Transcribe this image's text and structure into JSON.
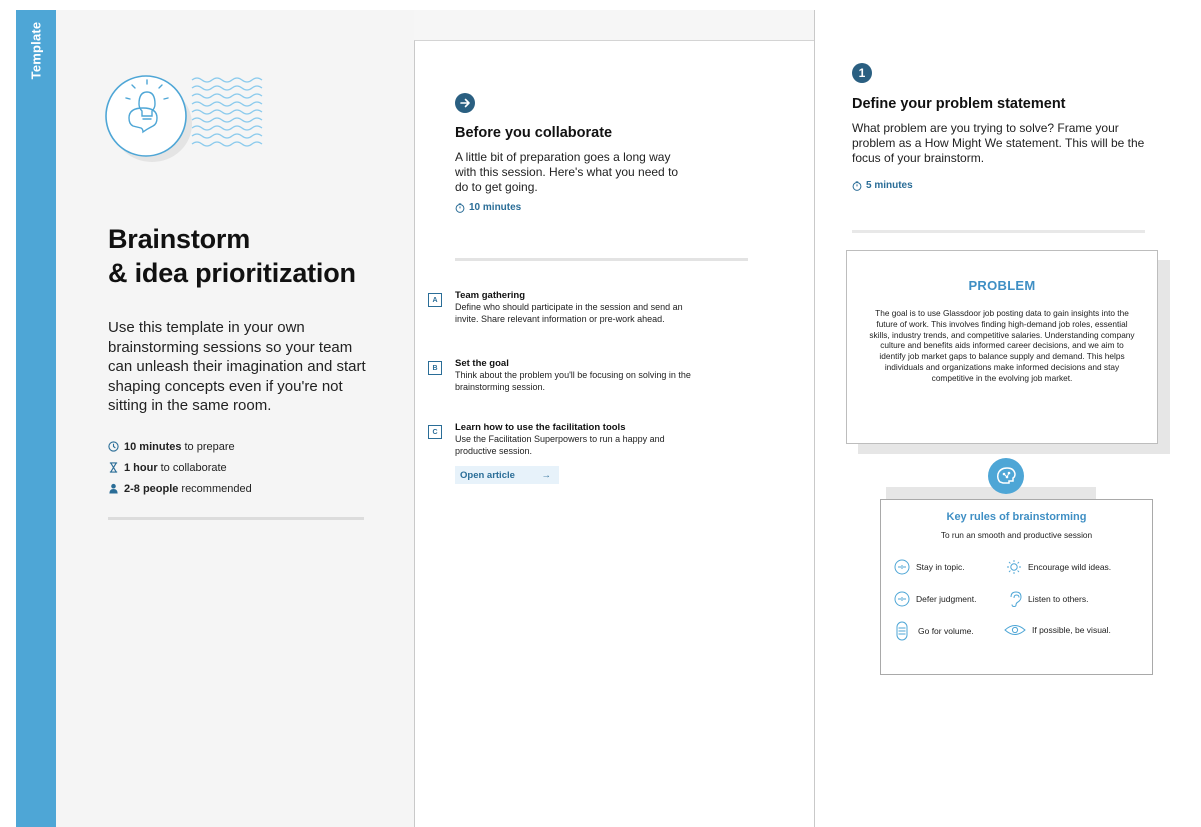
{
  "sidebar": {
    "label": "Template"
  },
  "intro": {
    "title_line1": "Brainstorm",
    "title_line2": "& idea prioritization",
    "description": "Use this template in your own brainstorming sessions so your team can unleash their imagination and start shaping concepts even if you're not sitting in the same room.",
    "meta": [
      {
        "icon": "clock-icon",
        "bold": "10 minutes",
        "text": "to prepare"
      },
      {
        "icon": "hourglass-icon",
        "bold": "1 hour",
        "text": "to collaborate"
      },
      {
        "icon": "person-icon",
        "bold": "2-8 people",
        "text": "recommended"
      }
    ]
  },
  "prep": {
    "heading": "Before you collaborate",
    "description": "A little bit of preparation goes a long way with this session. Here's what you need to do to get going.",
    "timer": "10 minutes",
    "steps": [
      {
        "letter": "A",
        "title": "Team gathering",
        "desc": "Define who should participate in the session and send an invite. Share relevant information or pre-work ahead."
      },
      {
        "letter": "B",
        "title": "Set the goal",
        "desc": "Think about the problem you'll be focusing on solving in the brainstorming session."
      },
      {
        "letter": "C",
        "title": "Learn how to use the facilitation tools",
        "desc": "Use the Facilitation Superpowers to run a happy and productive session."
      }
    ],
    "open_article": "Open article",
    "open_article_arrow": "→"
  },
  "define": {
    "step_number": "1",
    "heading": "Define your problem statement",
    "description": "What problem are you trying to solve? Frame your problem as a How Might We statement. This will be the focus of your brainstorm.",
    "timer": "5 minutes"
  },
  "problem": {
    "title": "PROBLEM",
    "text": "The goal is to use Glassdoor job posting data to gain insights into the future of work. This involves finding high-demand job roles, essential skills, industry trends, and competitive salaries. Understanding company culture and benefits aids informed career decisions, and we aim to identify job market gaps to balance supply and demand. This helps individuals and organizations make informed decisions and stay competitive in the evolving job market."
  },
  "rules": {
    "title": "Key rules of brainstorming",
    "subtitle": "To run an smooth and productive session",
    "items": [
      {
        "icon": "face-icon",
        "label": "Stay in topic."
      },
      {
        "icon": "lightbulb-icon",
        "label": "Encourage wild ideas."
      },
      {
        "icon": "face-icon",
        "label": "Defer judgment."
      },
      {
        "icon": "ear-icon",
        "label": "Listen to others."
      },
      {
        "icon": "stack-icon",
        "label": "Go for volume."
      },
      {
        "icon": "eye-icon",
        "label": "If possible, be visual."
      }
    ]
  },
  "colors": {
    "accent": "#4ea6d6",
    "dark_accent": "#2a5f81",
    "link": "#2a6d97",
    "title_blue": "#3f8fc4"
  }
}
